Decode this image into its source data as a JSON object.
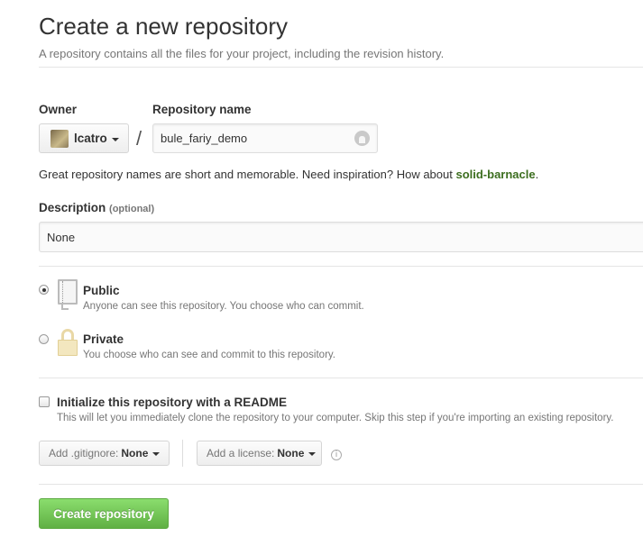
{
  "header": {
    "title": "Create a new repository",
    "subtitle": "A repository contains all the files for your project, including the revision history."
  },
  "owner": {
    "label": "Owner",
    "value": "lcatro",
    "separator": "/"
  },
  "repo_name": {
    "label": "Repository name",
    "value": "bule_fariy_demo"
  },
  "hint": {
    "prefix": "Great repository names are short and memorable. Need inspiration? How about ",
    "suggestion": "solid-barnacle",
    "suffix": "."
  },
  "description": {
    "label": "Description",
    "optional": "(optional)",
    "value": "None"
  },
  "visibility": {
    "selected": "public",
    "public": {
      "title": "Public",
      "desc": "Anyone can see this repository. You choose who can commit.",
      "icon": "repo-book-icon"
    },
    "private": {
      "title": "Private",
      "desc": "You choose who can see and commit to this repository.",
      "icon": "lock-icon"
    }
  },
  "readme": {
    "checked": false,
    "title": "Initialize this repository with a README",
    "desc": "This will let you immediately clone the repository to your computer. Skip this step if you're importing an existing repository."
  },
  "gitignore": {
    "prefix": "Add .gitignore:",
    "value": "None"
  },
  "license": {
    "prefix": "Add a license:",
    "value": "None"
  },
  "info_icon": "i",
  "create_button": {
    "label": "Create repository",
    "color": "#60b044"
  },
  "colors": {
    "suggestion": "#3c6e1f",
    "muted_text": "#767676"
  }
}
